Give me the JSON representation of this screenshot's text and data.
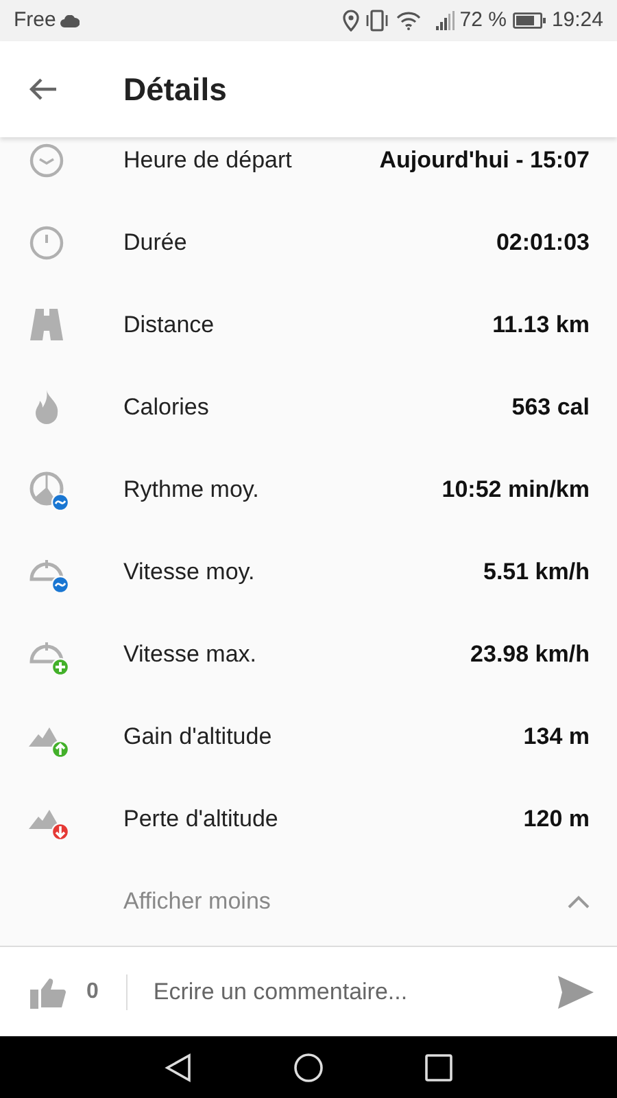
{
  "status_bar": {
    "carrier": "Free",
    "battery": "72 %",
    "time": "19:24"
  },
  "app_bar": {
    "title": "Détails"
  },
  "rows": [
    {
      "kind": "clock",
      "label": "Heure de départ",
      "value": "Aujourd'hui - 15:07"
    },
    {
      "kind": "stopwatch",
      "label": "Durée",
      "value": "02:01:03"
    },
    {
      "kind": "road",
      "label": "Distance",
      "value": "11.13 km"
    },
    {
      "kind": "flame",
      "label": "Calories",
      "value": "563 cal"
    },
    {
      "kind": "pace",
      "label": "Rythme moy.",
      "value": "10:52 min/km"
    },
    {
      "kind": "speed_avg",
      "label": "Vitesse moy.",
      "value": "5.51 km/h"
    },
    {
      "kind": "speed_max",
      "label": "Vitesse max.",
      "value": "23.98 km/h"
    },
    {
      "kind": "gain",
      "label": "Gain d'altitude",
      "value": "134 m"
    },
    {
      "kind": "loss",
      "label": "Perte d'altitude",
      "value": "120 m"
    }
  ],
  "toggle": {
    "label": "Afficher moins",
    "expanded": true
  },
  "comment_bar": {
    "likes": "0",
    "placeholder": "Ecrire un commentaire..."
  }
}
